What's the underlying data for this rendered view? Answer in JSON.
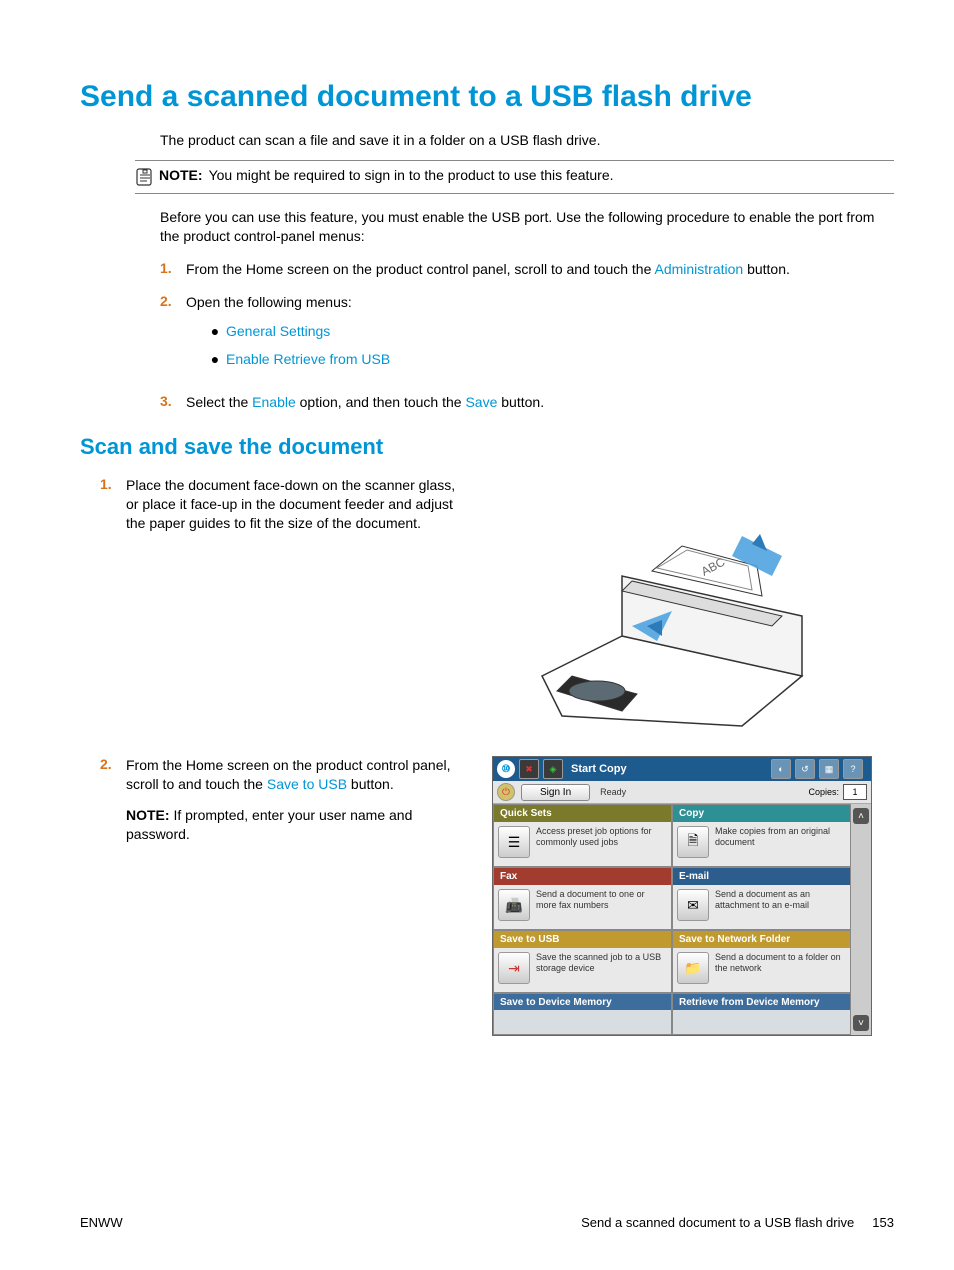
{
  "title": "Send a scanned document to a USB flash drive",
  "intro": "The product can scan a file and save it in a folder on a USB flash drive.",
  "note": {
    "label": "NOTE:",
    "text": "You might be required to sign in to the product to use this feature."
  },
  "pre_para": "Before you can use this feature, you must enable the USB port. Use the following procedure to enable the port from the product control-panel menus:",
  "steps_a": {
    "s1_a": "From the Home screen on the product control panel, scroll to and touch the ",
    "s1_link": "Administration",
    "s1_b": " button.",
    "s2": "Open the following menus:",
    "bul1": "General Settings",
    "bul2": "Enable Retrieve from USB",
    "s3_a": "Select the ",
    "s3_l1": "Enable",
    "s3_b": " option, and then touch the ",
    "s3_l2": "Save",
    "s3_c": " button."
  },
  "h2": "Scan and save the document",
  "steps_b": {
    "s1": "Place the document face-down on the scanner glass, or place it face-up in the document feeder and adjust the paper guides to fit the size of the document.",
    "s2_a": "From the Home screen on the product control panel, scroll to and touch the ",
    "s2_link": "Save to USB",
    "s2_b": " button.",
    "s2_note_label": "NOTE:",
    "s2_note_text": "If prompted, enter your user name and password."
  },
  "panel": {
    "start_copy": "Start Copy",
    "sign_in": "Sign In",
    "ready": "Ready",
    "copies_label": "Copies:",
    "copies_val": "1",
    "tiles": {
      "quick": {
        "h": "Quick Sets",
        "t": "Access preset job options for commonly used jobs"
      },
      "copy": {
        "h": "Copy",
        "t": "Make copies from an original document"
      },
      "fax": {
        "h": "Fax",
        "t": "Send a document to one or more fax numbers"
      },
      "email": {
        "h": "E-mail",
        "t": "Send a document as an attachment to an e-mail"
      },
      "usb": {
        "h": "Save to USB",
        "t": "Save the scanned job to a USB storage device"
      },
      "net": {
        "h": "Save to Network Folder",
        "t": "Send a document to a folder on the network"
      },
      "devmem": {
        "h": "Save to Device Memory"
      },
      "retmem": {
        "h": "Retrieve from Device Memory"
      }
    }
  },
  "footer": {
    "left": "ENWW",
    "right_text": "Send a scanned document to a USB flash drive",
    "page": "153"
  },
  "illustration_label": "ABC"
}
